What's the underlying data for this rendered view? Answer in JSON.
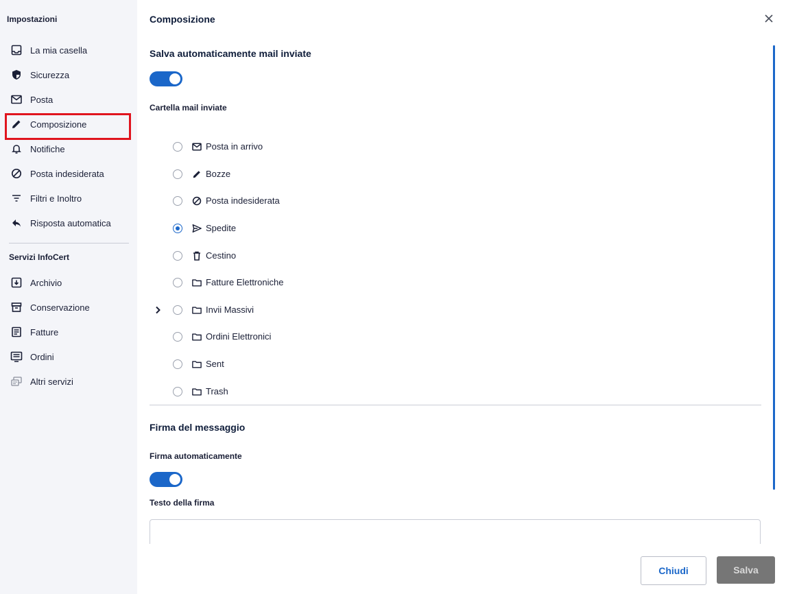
{
  "sidebar": {
    "heading": "Impostazioni",
    "items": [
      {
        "label": "La mia casella",
        "icon": "inbox-icon"
      },
      {
        "label": "Sicurezza",
        "icon": "shield-icon"
      },
      {
        "label": "Posta",
        "icon": "mail-icon"
      },
      {
        "label": "Composizione",
        "icon": "pencil-icon"
      },
      {
        "label": "Notifiche",
        "icon": "bell-icon"
      },
      {
        "label": "Posta indesiderata",
        "icon": "block-icon"
      },
      {
        "label": "Filtri e Inoltro",
        "icon": "filter-icon"
      },
      {
        "label": "Risposta automatica",
        "icon": "reply-icon"
      }
    ],
    "services_heading": "Servizi InfoCert",
    "services": [
      {
        "label": "Archivio",
        "icon": "archive-icon"
      },
      {
        "label": "Conservazione",
        "icon": "storage-box-icon"
      },
      {
        "label": "Fatture",
        "icon": "invoice-icon"
      },
      {
        "label": "Ordini",
        "icon": "orders-icon"
      },
      {
        "label": "Altri servizi",
        "icon": "other-services-icon"
      }
    ],
    "selected": "Composizione"
  },
  "main": {
    "title": "Composizione",
    "autosave": {
      "title": "Salva automaticamente mail inviate",
      "enabled": true
    },
    "sent_folder": {
      "label": "Cartella mail inviate",
      "selected": "Spedite",
      "folders": [
        {
          "label": "Posta in arrivo",
          "icon": "mail-icon"
        },
        {
          "label": "Bozze",
          "icon": "pencil-icon"
        },
        {
          "label": "Posta indesiderata",
          "icon": "block-icon"
        },
        {
          "label": "Spedite",
          "icon": "send-icon"
        },
        {
          "label": "Cestino",
          "icon": "trash-icon"
        },
        {
          "label": "Fatture Elettroniche",
          "icon": "folder-icon"
        },
        {
          "label": "Invii Massivi",
          "icon": "folder-icon",
          "expandable": true
        },
        {
          "label": "Ordini Elettronici",
          "icon": "folder-icon"
        },
        {
          "label": "Sent",
          "icon": "folder-icon"
        },
        {
          "label": "Trash",
          "icon": "folder-icon"
        }
      ]
    },
    "signature": {
      "title": "Firma del messaggio",
      "auto_label": "Firma automaticamente",
      "auto_enabled": true,
      "text_label": "Testo della firma",
      "text_value": ""
    }
  },
  "footer": {
    "close_label": "Chiudi",
    "save_label": "Salva"
  },
  "colors": {
    "accent": "#1b67c9",
    "highlight": "#e0141e",
    "sidebar_bg": "#f4f5f9",
    "disabled_button": "#767676"
  }
}
